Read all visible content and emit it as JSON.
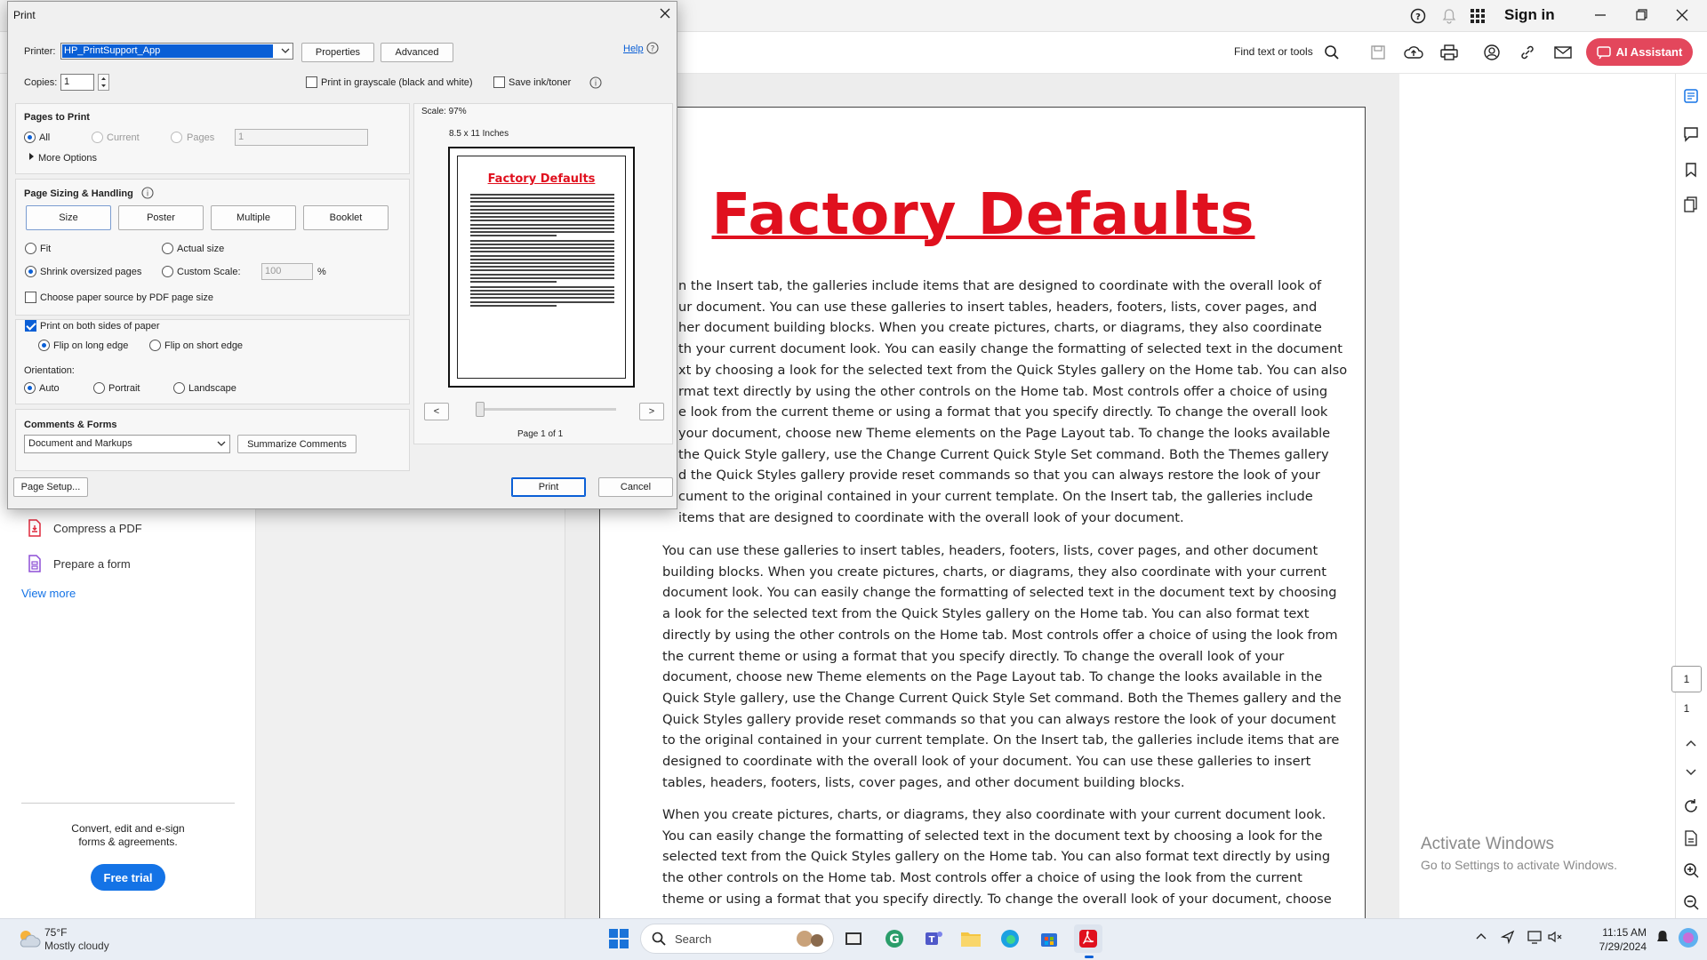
{
  "app": {
    "sign_in": "Sign in",
    "find_text": "Find text or tools",
    "ai_assistant": "AI Assistant"
  },
  "left_panel": {
    "items": [
      {
        "label": "Compress a PDF",
        "icon": "compress-pdf-icon",
        "color": "#e0293c"
      },
      {
        "label": "Prepare a form",
        "icon": "prepare-form-icon",
        "color": "#8d4fd6"
      }
    ],
    "view_more": "View more",
    "promo_line1": "Convert, edit and e-sign",
    "promo_line2": "forms & agreements.",
    "free_trial": "Free trial"
  },
  "document": {
    "title": "Factory Defaults",
    "p1_lines": [
      "n the Insert tab, the galleries include items that are designed to coordinate with the overall look of",
      "ur document. You can use these galleries to insert tables, headers, footers, lists, cover pages, and",
      "her document building blocks. When you create pictures, charts, or diagrams, they also coordinate",
      "th your current document look. You can easily change the formatting of selected text in the document",
      "xt by choosing a look for the selected text from the Quick Styles gallery on the Home tab. You can also",
      "rmat text directly by using the other controls on the Home tab. Most controls offer a choice of using",
      "e look from the current theme or using a format that you specify directly. To change the overall look",
      "your document, choose new Theme elements on the Page Layout tab. To change the looks available",
      "the Quick Style gallery, use the Change Current Quick Style Set command. Both the Themes gallery",
      "d the Quick Styles gallery provide reset commands so that you can always restore the look of your",
      "cument to the original contained in your current template. On the Insert tab, the galleries include",
      "items that are designed to coordinate with the overall look of your document."
    ],
    "p2_lines": [
      "You can use these galleries to insert tables, headers, footers, lists, cover pages, and other document",
      "building blocks. When you create pictures, charts, or diagrams, they also coordinate with your current",
      "document look. You can easily change the formatting of selected text in the document text by choosing",
      "a look for the selected text from the Quick Styles gallery on the Home tab. You can also format text",
      "directly by using the other controls on the Home tab. Most controls offer a choice of using the look from",
      "the current theme or using a format that you specify directly. To change the overall look of your",
      "document, choose new Theme elements on the Page Layout tab. To change the looks available in the",
      "Quick Style gallery, use the Change Current Quick Style Set command. Both the Themes gallery and the",
      "Quick Styles gallery provide reset commands so that you can always restore the look of your document",
      "to the original contained in your current template. On the Insert tab, the galleries include items that are",
      "designed to coordinate with the overall look of your document. You can use these galleries to insert",
      "tables, headers, footers, lists, cover pages, and other document building blocks."
    ],
    "p3_lines": [
      "When you create pictures, charts, or diagrams, they also coordinate with your current document look.",
      "You can easily change the formatting of selected text in the document text by choosing a look for the",
      "selected text from the Quick Styles gallery on the Home tab. You can also format text directly by using",
      "the other controls on the Home tab. Most controls offer a choice of using the look from the current",
      "theme or using a format that you specify directly. To change the overall look of your document, choose"
    ]
  },
  "page_nav": {
    "current": "1",
    "total": "1"
  },
  "watermark": {
    "line1": "Activate Windows",
    "line2": "Go to Settings to activate Windows."
  },
  "taskbar": {
    "temp": "75°F",
    "weather": "Mostly cloudy",
    "search": "Search",
    "time": "11:15 AM",
    "date": "7/29/2024"
  },
  "dialog": {
    "title": "Print",
    "printer_label": "Printer:",
    "printer_value": "HP_PrintSupport_App",
    "properties": "Properties",
    "advanced": "Advanced",
    "help": "Help",
    "copies_label": "Copies:",
    "copies_value": "1",
    "grayscale": "Print in grayscale (black and white)",
    "save_ink": "Save ink/toner",
    "pages_to_print": "Pages to Print",
    "all": "All",
    "current": "Current",
    "pages": "Pages",
    "pages_value": "1",
    "more_options": "More Options",
    "sizing": "Page Sizing & Handling",
    "size": "Size",
    "poster": "Poster",
    "multiple": "Multiple",
    "booklet": "Booklet",
    "fit": "Fit",
    "actual_size": "Actual size",
    "shrink": "Shrink oversized pages",
    "custom_scale": "Custom Scale:",
    "custom_value": "100",
    "percent": "%",
    "choose_paper": "Choose paper source by PDF page size",
    "both_sides": "Print on both sides of paper",
    "flip_long": "Flip on long edge",
    "flip_short": "Flip on short edge",
    "orientation": "Orientation:",
    "auto": "Auto",
    "portrait": "Portrait",
    "landscape": "Landscape",
    "comments_forms": "Comments & Forms",
    "comments_value": "Document and Markups",
    "summarize": "Summarize Comments",
    "scale": "Scale:  97%",
    "paper_size": "8.5 x 11 Inches",
    "preview_title": "Factory Defaults",
    "prev": "<",
    "next": ">",
    "page_of": "Page 1 of 1",
    "page_setup": "Page Setup...",
    "print": "Print",
    "cancel": "Cancel"
  }
}
